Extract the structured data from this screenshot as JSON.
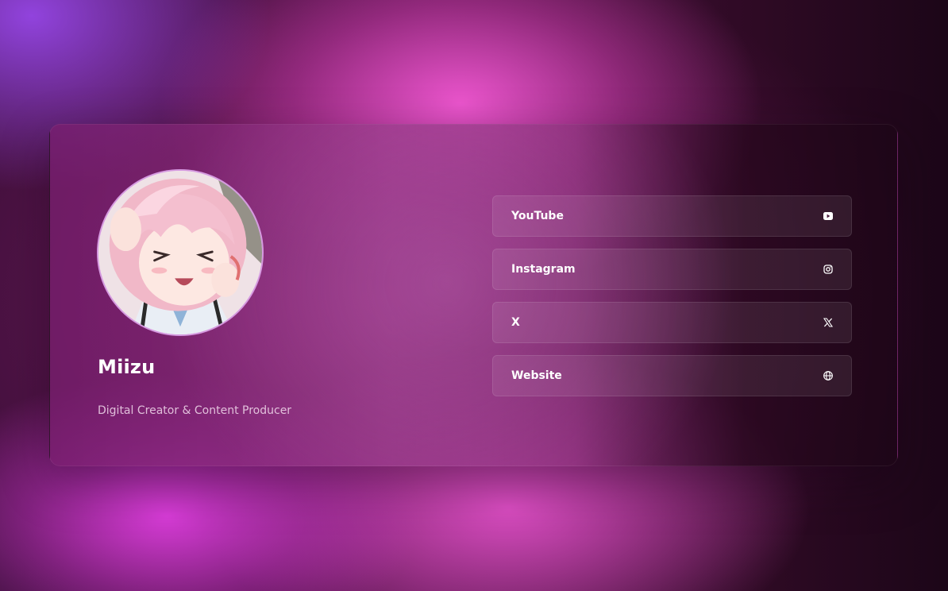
{
  "profile": {
    "name": "Miizu",
    "subtitle": "Digital Creator & Content Producer"
  },
  "links": [
    {
      "label": "YouTube",
      "icon": "youtube-icon"
    },
    {
      "label": "Instagram",
      "icon": "instagram-icon"
    },
    {
      "label": "X",
      "icon": "x-icon"
    },
    {
      "label": "Website",
      "icon": "globe-icon"
    }
  ],
  "colors": {
    "background": "#2a0a24",
    "accent_pink": "#e055cd",
    "accent_purple": "#9646e6",
    "text": "#ffffff"
  }
}
